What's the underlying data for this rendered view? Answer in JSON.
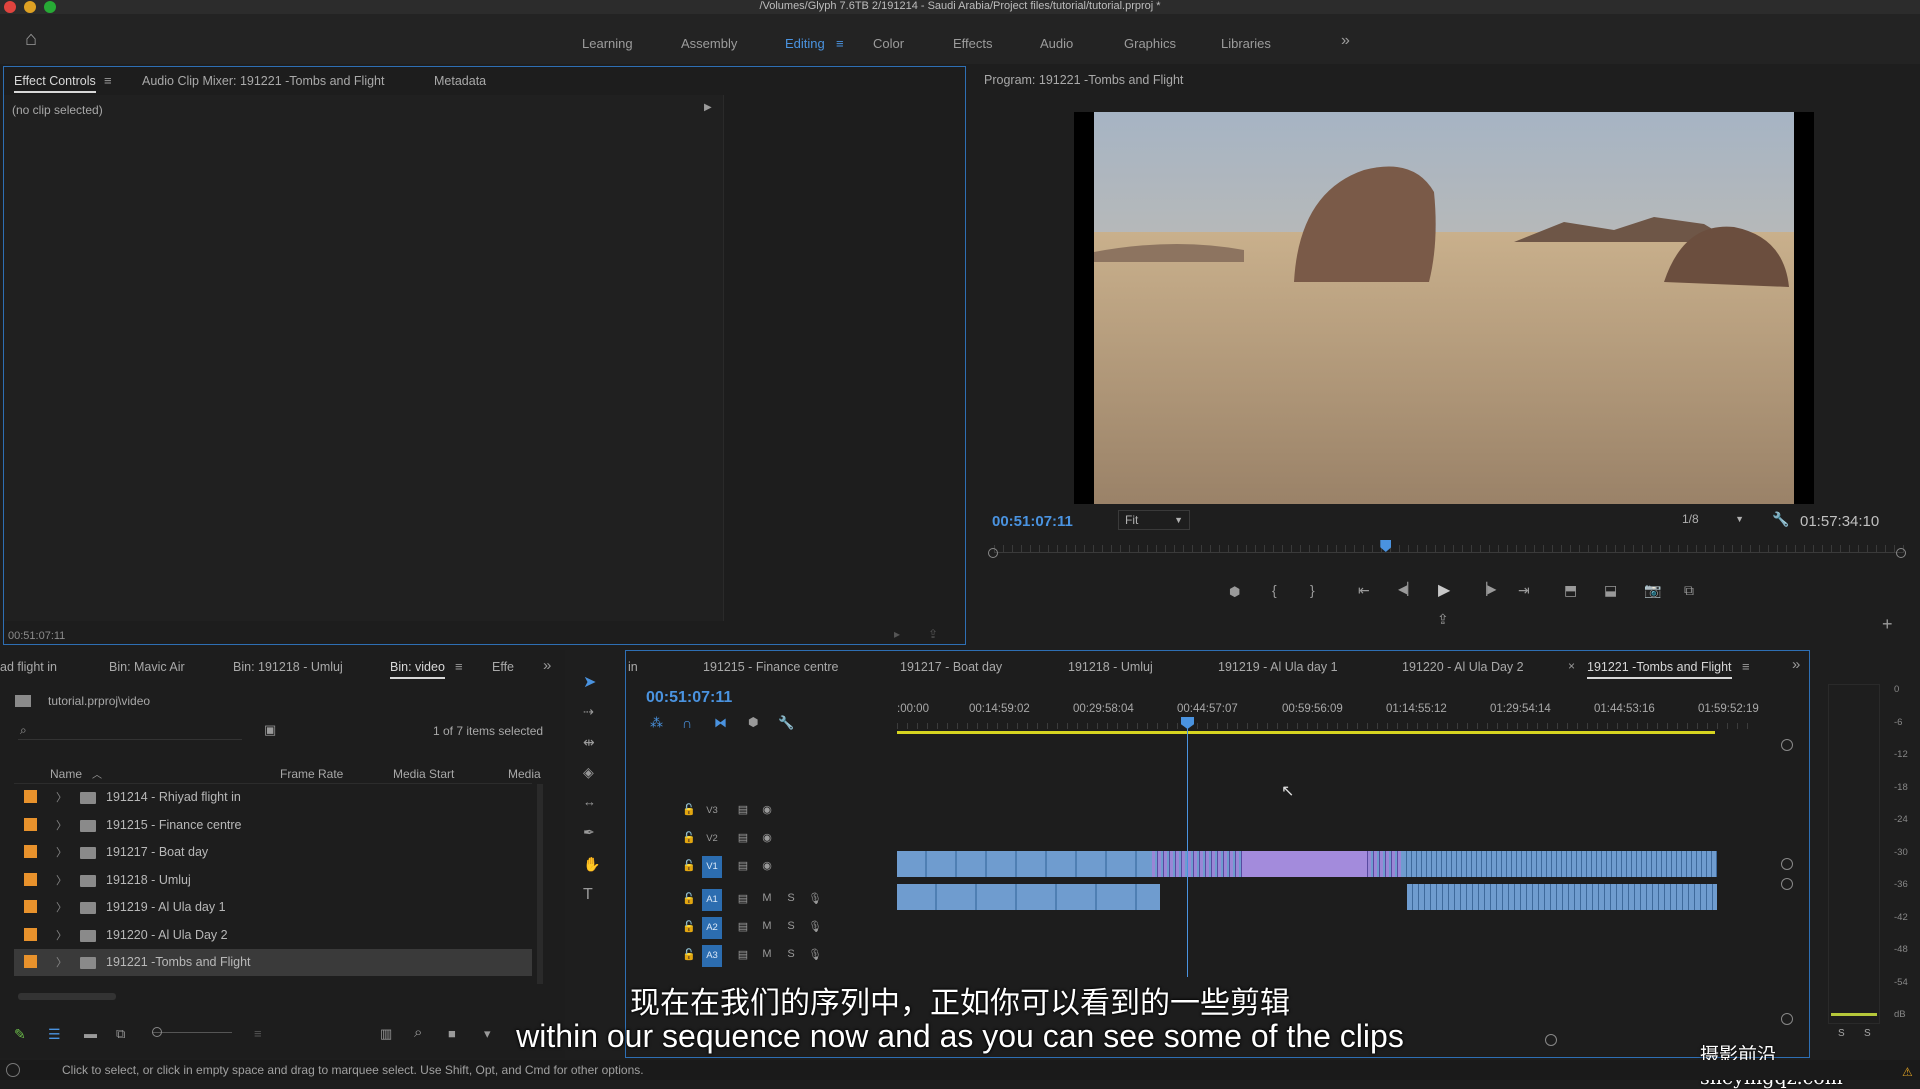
{
  "window": {
    "title": "/Volumes/Glyph 7.6TB 2/191214 - Saudi Arabia/Project files/tutorial/tutorial.prproj *"
  },
  "workspaces": {
    "items": [
      "Learning",
      "Assembly",
      "Editing",
      "Color",
      "Effects",
      "Audio",
      "Graphics",
      "Libraries"
    ],
    "active": "Editing",
    "overflow": "»"
  },
  "effect_controls": {
    "tabs": [
      "Effect Controls",
      "Audio Clip Mixer: 191221 -Tombs and Flight",
      "Metadata"
    ],
    "no_clip": "(no clip selected)",
    "timecode": "00:51:07:11"
  },
  "program": {
    "title": "Program: 191221 -Tombs and Flight",
    "timecode": "00:51:07:11",
    "fit": "Fit",
    "resolution": "1/8",
    "duration": "01:57:34:10",
    "playhead_fraction": 0.43
  },
  "project": {
    "tabs": [
      "ad flight in",
      "Bin: Mavic Air",
      "Bin: 191218 - Umluj",
      "Bin: video",
      "Effe"
    ],
    "active_tab": "Bin: video",
    "path": "tutorial.prproj\\video",
    "selection": "1 of 7 items selected",
    "columns": [
      "Name",
      "Frame Rate",
      "Media Start",
      "Media"
    ],
    "items": [
      "191214 - Rhiyad flight in",
      "191215 - Finance centre",
      "191217 - Boat day",
      "191218 - Umluj",
      "191219 - Al Ula day 1",
      "191220 - Al Ula Day 2",
      "191221 -Tombs and Flight"
    ],
    "selected_index": 6
  },
  "timeline": {
    "tabs": [
      "in",
      "191215 - Finance centre",
      "191217 - Boat day",
      "191218 - Umluj",
      "191219 - Al Ula day 1",
      "191220 - Al Ula Day 2",
      "191221 -Tombs and Flight"
    ],
    "active_tab": "191221 -Tombs and Flight",
    "timecode": "00:51:07:11",
    "ruler": [
      ":00:00",
      "00:14:59:02",
      "00:29:58:04",
      "00:44:57:07",
      "00:59:56:09",
      "01:14:55:12",
      "01:29:54:14",
      "01:44:53:16",
      "01:59:52:19"
    ],
    "video_tracks": [
      "V3",
      "V2",
      "V1"
    ],
    "audio_tracks": [
      "A1",
      "A2",
      "A3"
    ],
    "mute_label": "M",
    "solo_label": "S"
  },
  "meter": {
    "labels": [
      "0",
      "-6",
      "-12",
      "-18",
      "-24",
      "-30",
      "-36",
      "-42",
      "-48",
      "-54",
      "dB"
    ],
    "solo": [
      "S",
      "S"
    ]
  },
  "subtitles": {
    "zh": "现在在我们的序列中，正如你可以看到的一些剪辑",
    "en": "within our sequence now and as you can see some of the clips"
  },
  "watermark": "摄影前沿 sheyingqz.com",
  "status": "Click to select, or click in empty space and drag to marquee select. Use Shift, Opt, and Cmd for other options.",
  "colors": {
    "accent": "#4a93e0",
    "label_orange": "#e8922c",
    "clip_blue": "#6f9ccf",
    "clip_lavender": "#9a86d6",
    "work_area": "#d6d420"
  }
}
